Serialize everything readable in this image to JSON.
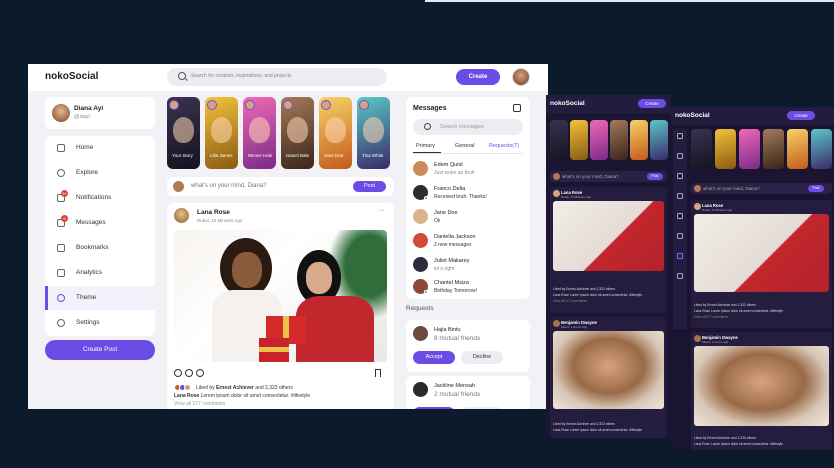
{
  "app": {
    "logo": "nokoSocial",
    "search_placeholder": "Search for creators, inspirations, and projects",
    "create_label": "Create"
  },
  "profile": {
    "name": "Diana Ayi",
    "handle": "@dayi"
  },
  "menu": [
    {
      "label": "Home",
      "icon": "home-icon",
      "active": false
    },
    {
      "label": "Explore",
      "icon": "compass-icon",
      "active": false
    },
    {
      "label": "Notifications",
      "icon": "bell-icon",
      "badge": "9+",
      "active": false
    },
    {
      "label": "Messages",
      "icon": "envelope-icon",
      "badge": "6",
      "active": false
    },
    {
      "label": "Bookmarks",
      "icon": "bookmark-icon",
      "active": false
    },
    {
      "label": "Analytics",
      "icon": "chart-icon",
      "active": false
    },
    {
      "label": "Theme",
      "icon": "palette-icon",
      "active": true
    },
    {
      "label": "Settings",
      "icon": "gear-icon",
      "active": false
    }
  ],
  "create_post_label": "Create Post",
  "stories": [
    {
      "name": "Your Story",
      "color": "#2a2338"
    },
    {
      "name": "Lilla James",
      "color": "#d7a628"
    },
    {
      "name": "Winnie Hale",
      "color": "#e04a9a"
    },
    {
      "name": "Daniel Bale",
      "color": "#6d4a3a"
    },
    {
      "name": "Jane Doe",
      "color": "#e8a23e"
    },
    {
      "name": "Tina White",
      "color": "#3aa7a8"
    }
  ],
  "composer": {
    "placeholder": "what's on your mind, Diana?",
    "post_label": "Post"
  },
  "feed_post": {
    "author": "Lana Rose",
    "meta": "Dubai, 15 Minutes Ago",
    "more": "···",
    "liked_prefix": "Liked by ",
    "liked_name": "Ernest Achiever",
    "liked_suffix": " and 2,323 others",
    "caption_author": "Lana Rose",
    "caption_text": " Lorem ipsum dolor sit amet consectetur. #lifestyle",
    "view_all": "View all 277 comments"
  },
  "messages": {
    "title": "Messages",
    "search_placeholder": "Search messages",
    "tabs": [
      "Primary",
      "General",
      "Requests(7)"
    ],
    "items": [
      {
        "name": "Edem Quist",
        "text": "Just woke up bruh",
        "color": "#c98a5c",
        "online": false,
        "dark": false
      },
      {
        "name": "Franco Delia",
        "text": "Received bruh. Thanks!",
        "color": "#2d2d2d",
        "online": true,
        "dark": true
      },
      {
        "name": "Jane Doe",
        "text": "Ok",
        "color": "#d9b38c",
        "online": false,
        "dark": true
      },
      {
        "name": "Daniella Jackson",
        "text": "2 new messages",
        "color": "#d24a3a",
        "online": false,
        "dark": true
      },
      {
        "name": "Juliet Makarey",
        "text": "lol u right",
        "color": "#2f2a3a",
        "online": false,
        "dark": false
      },
      {
        "name": "Chantel Msiza",
        "text": "Birthday Tomorrow!",
        "color": "#8a4a3a",
        "online": true,
        "dark": true
      }
    ]
  },
  "requests": {
    "title": "Requests",
    "items": [
      {
        "name": "Hajia Bintu",
        "mutual": "8 mutual friends",
        "accept": "Accept",
        "decline": "Decline",
        "color": "#6a4a3a"
      },
      {
        "name": "Jackline Mensah",
        "mutual": "2 mutual friends",
        "color": "#2a2a2a"
      }
    ]
  },
  "dark_preview_1": {
    "logo": "nokoSocial",
    "create_label": "Create",
    "composer_text": "what's on your mind, Diana?",
    "post_label": "Post",
    "post1_author": "Lana Rose",
    "post1_meta": "Dubai, 15 Minutes Ago",
    "post1_liked": "Liked by Ernest Achiever and 2,323 others",
    "post1_caption": "Lana Rose Lorem ipsum dolor sit amet consectetur. #lifestyle",
    "post1_view": "View all 277 comments",
    "post2_author": "Benjamin Dwayne",
    "post2_meta": "Miami, 2 Hours Ago",
    "post2_liked": "Liked by Ernest Achiever and 2,323 others",
    "post2_caption": "Lana Rose Lorem ipsum dolor sit amet consectetur. #lifestyle"
  },
  "dark_preview_2": {
    "logo": "nokoSocial",
    "create_label": "Create",
    "composer_text": "what's on your mind, Diana?",
    "post_label": "Post",
    "post1_author": "Lana Rose",
    "post1_meta": "Dubai, 15 Minutes Ago",
    "post1_liked": "Liked by Ernest Achiever and 2,323 others",
    "post1_caption": "Lana Rose Lorem ipsum dolor sit amet consectetur. #lifestyle",
    "post1_view": "View all 277 comments",
    "post2_author": "Benjamin Dwayne",
    "post2_meta": "Miami, 2 Hours Ago",
    "post2_liked": "Liked by Ernest Achiever and 2,323 others",
    "post2_caption": "Lana Rose Lorem ipsum dolor sit amet consectetur. #lifestyle"
  },
  "colors": {
    "accent": "#6b4de6",
    "background": "#0b1b2b",
    "dark_surface": "#1a1530"
  }
}
